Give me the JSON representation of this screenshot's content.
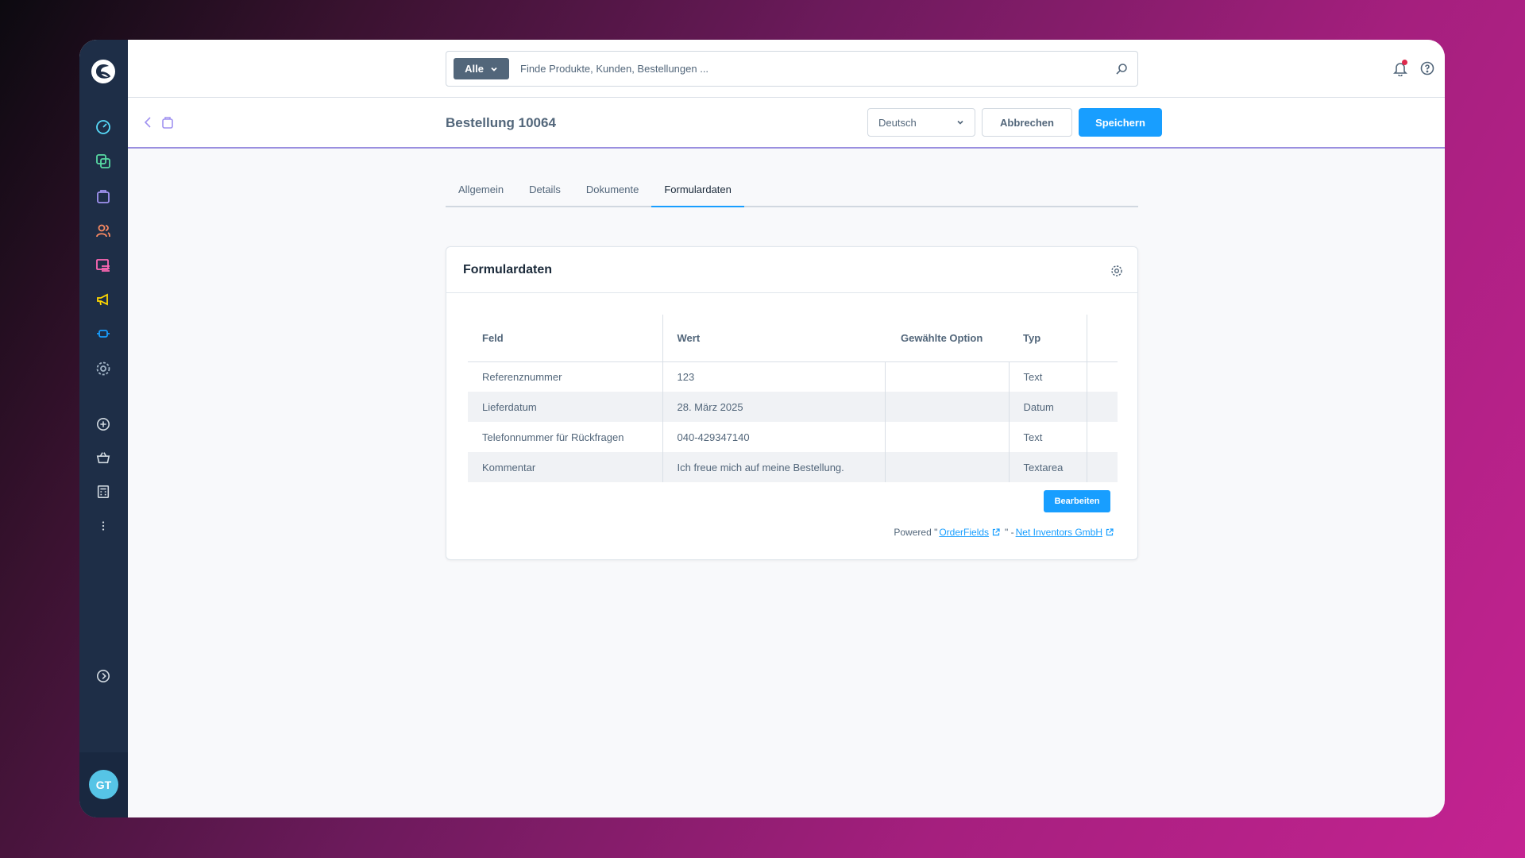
{
  "sidebar": {
    "nav": [
      {
        "name": "dashboard-icon",
        "color": "#57d9f8"
      },
      {
        "name": "catalogue-icon",
        "color": "#57d9a3"
      },
      {
        "name": "orders-icon",
        "color": "#a092f0"
      },
      {
        "name": "customers-icon",
        "color": "#f88962"
      },
      {
        "name": "content-icon",
        "color": "#ff68b4"
      },
      {
        "name": "marketing-icon",
        "color": "#ffd700"
      },
      {
        "name": "extensions-icon",
        "color": "#189eff"
      },
      {
        "name": "settings-icon",
        "color": "#a2b4c6"
      },
      {
        "name": "add-icon",
        "color": "#d1d9e0"
      },
      {
        "name": "basket-icon",
        "color": "#d1d9e0"
      },
      {
        "name": "calculator-icon",
        "color": "#d1d9e0"
      },
      {
        "name": "more-icon",
        "color": "#d1d9e0"
      }
    ],
    "avatar_initials": "GT"
  },
  "search": {
    "type_label": "Alle",
    "placeholder": "Finde Produkte, Kunden, Bestellungen ..."
  },
  "header": {
    "title": "Bestellung 10064",
    "language": "Deutsch",
    "cancel_label": "Abbrechen",
    "save_label": "Speichern"
  },
  "tabs": [
    {
      "label": "Allgemein",
      "active": false
    },
    {
      "label": "Details",
      "active": false
    },
    {
      "label": "Dokumente",
      "active": false
    },
    {
      "label": "Formulardaten",
      "active": true
    }
  ],
  "card": {
    "title": "Formulardaten",
    "columns": [
      "Feld",
      "Wert",
      "Gewählte Option",
      "Typ"
    ],
    "rows": [
      {
        "feld": "Referenznummer",
        "wert": "123",
        "option": "",
        "typ": "Text"
      },
      {
        "feld": "Lieferdatum",
        "wert": "28. März 2025",
        "option": "",
        "typ": "Datum"
      },
      {
        "feld": "Telefonnummer für Rückfragen",
        "wert": "040-429347140",
        "option": "",
        "typ": "Text"
      },
      {
        "feld": "Kommentar",
        "wert": "Ich freue mich auf meine Bestellung.",
        "option": "",
        "typ": "Textarea"
      }
    ],
    "edit_label": "Bearbeiten",
    "powered_prefix": "Powered \"",
    "powered_link1": "OrderFields",
    "powered_mid": "\" - ",
    "powered_link2": "Net Inventors GmbH"
  },
  "colors": {
    "primary": "#189eff",
    "sidebar": "#1e2e47"
  }
}
